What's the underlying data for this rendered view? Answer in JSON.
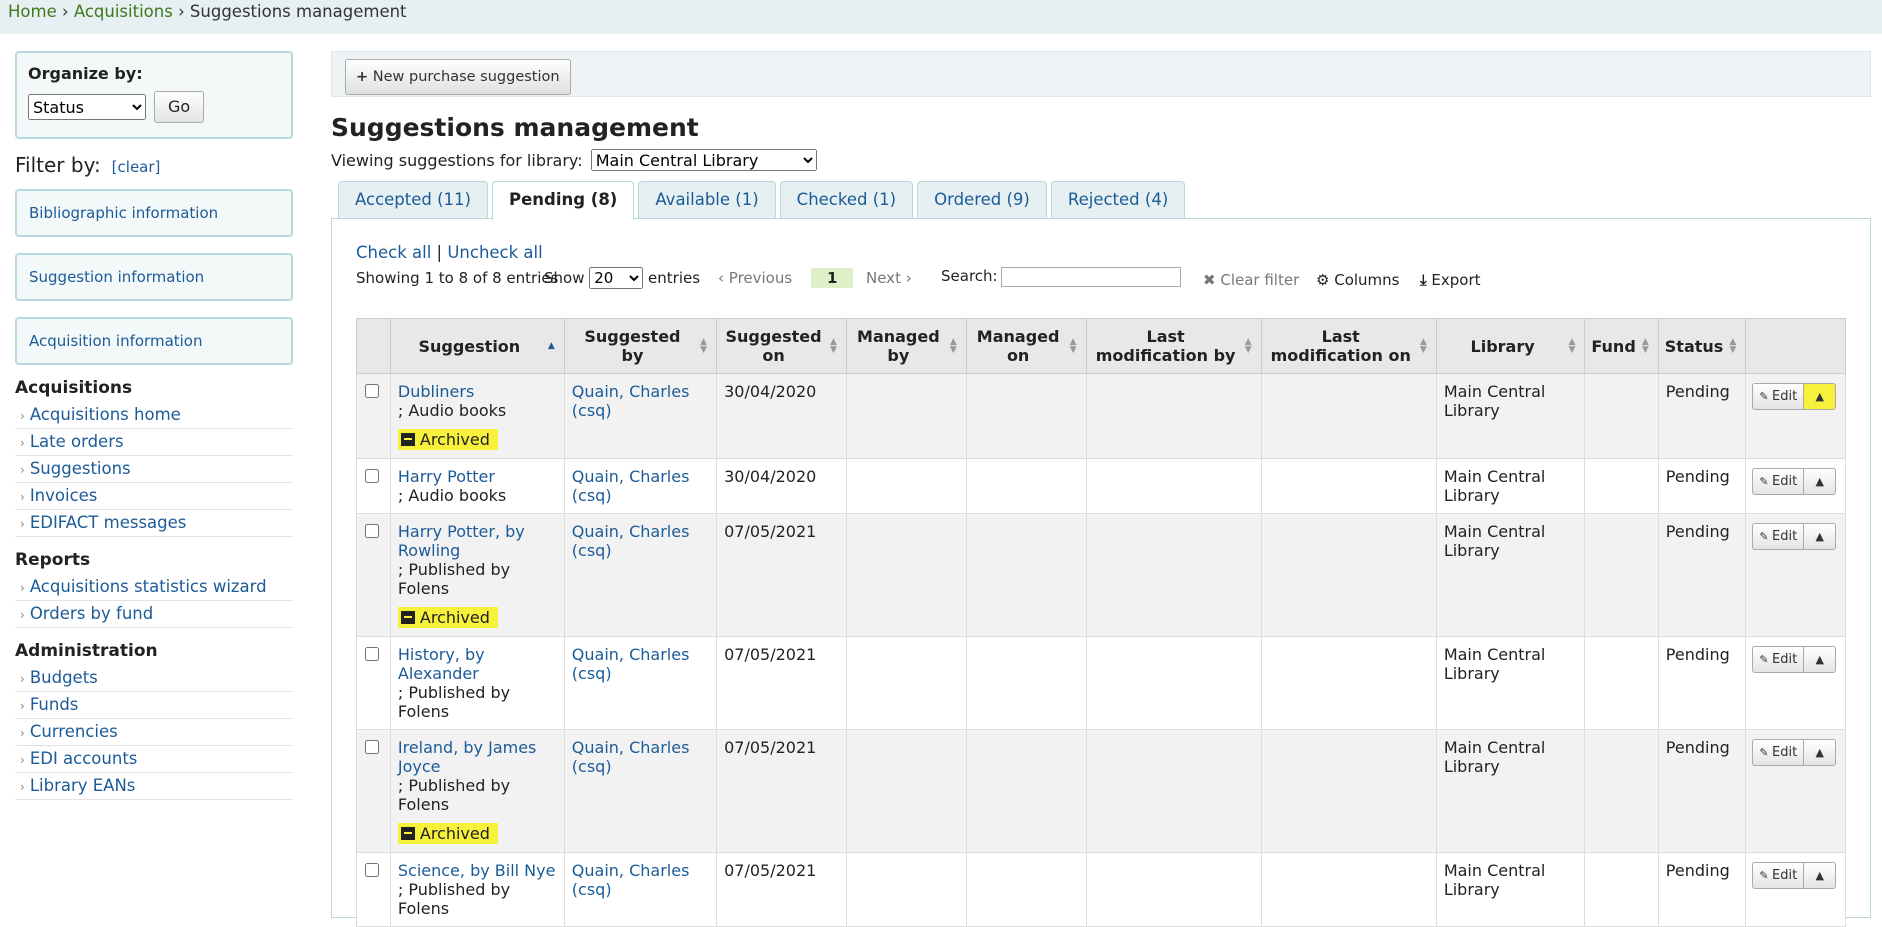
{
  "breadcrumb": {
    "home": "Home",
    "acq": "Acquisitions",
    "current": "Suggestions management",
    "sep": "›"
  },
  "sidebar": {
    "organize_label": "Organize by:",
    "organize_value": "Status",
    "go_label": "Go",
    "filter_label": "Filter by:",
    "clear_label": "[clear]",
    "filter_boxes": [
      "Bibliographic information",
      "Suggestion information",
      "Acquisition information"
    ],
    "acquisitions_heading": "Acquisitions",
    "acquisitions_items": [
      "Acquisitions home",
      "Late orders",
      "Suggestions",
      "Invoices",
      "EDIFACT messages"
    ],
    "reports_heading": "Reports",
    "reports_items": [
      "Acquisitions statistics wizard",
      "Orders by fund"
    ],
    "admin_heading": "Administration",
    "admin_items": [
      "Budgets",
      "Funds",
      "Currencies",
      "EDI accounts",
      "Library EANs"
    ]
  },
  "toolbar": {
    "new_suggestion": "New purchase suggestion"
  },
  "page_title": "Suggestions management",
  "library_label": "Viewing suggestions for library:",
  "library_value": "Main Central Library",
  "tabs": [
    "Accepted (11)",
    "Pending (8)",
    "Available (1)",
    "Checked (1)",
    "Ordered (9)",
    "Rejected (4)"
  ],
  "active_tab": 1,
  "check_all": "Check all",
  "uncheck_all": "Uncheck all",
  "info_text": "Showing 1 to 8 of 8 entries",
  "show_label": "Show",
  "show_value": "20",
  "entries_label": "entries",
  "previous": "Previous",
  "page": "1",
  "next": "Next",
  "search_label": "Search:",
  "clear_filter": "Clear filter",
  "columns": "Columns",
  "export": "Export",
  "table": {
    "headers": [
      "Suggestion",
      "Suggested by",
      "Suggested on",
      "Managed by",
      "Managed on",
      "Last modification by",
      "Last modification on",
      "Library",
      "Fund",
      "Status"
    ],
    "archived_label": "Archived",
    "edit_label": "Edit",
    "rows": [
      {
        "title": "Dubliners",
        "sub": "; Audio books",
        "by": "Quain, Charles (csq)",
        "on": "30/04/2020",
        "library": "Main Central Library",
        "status": "Pending",
        "archived": true,
        "hl": true
      },
      {
        "title": "Harry Potter",
        "sub": "; Audio books",
        "by": "Quain, Charles (csq)",
        "on": "30/04/2020",
        "library": "Main Central Library",
        "status": "Pending",
        "archived": false,
        "hl": false
      },
      {
        "title": "Harry Potter, by Rowling",
        "sub": "; Published by Folens",
        "by": "Quain, Charles (csq)",
        "on": "07/05/2021",
        "library": "Main Central Library",
        "status": "Pending",
        "archived": true,
        "hl": false
      },
      {
        "title": "History, by Alexander",
        "sub": "; Published by Folens",
        "by": "Quain, Charles (csq)",
        "on": "07/05/2021",
        "library": "Main Central Library",
        "status": "Pending",
        "archived": false,
        "hl": false
      },
      {
        "title": "Ireland, by James Joyce",
        "sub": "; Published by Folens",
        "by": "Quain, Charles (csq)",
        "on": "07/05/2021",
        "library": "Main Central Library",
        "status": "Pending",
        "archived": true,
        "hl": false
      },
      {
        "title": "Science, by Bill Nye",
        "sub": "; Published by Folens",
        "by": "Quain, Charles (csq)",
        "on": "07/05/2021",
        "library": "Main Central Library",
        "status": "Pending",
        "archived": false,
        "hl": false
      }
    ]
  }
}
